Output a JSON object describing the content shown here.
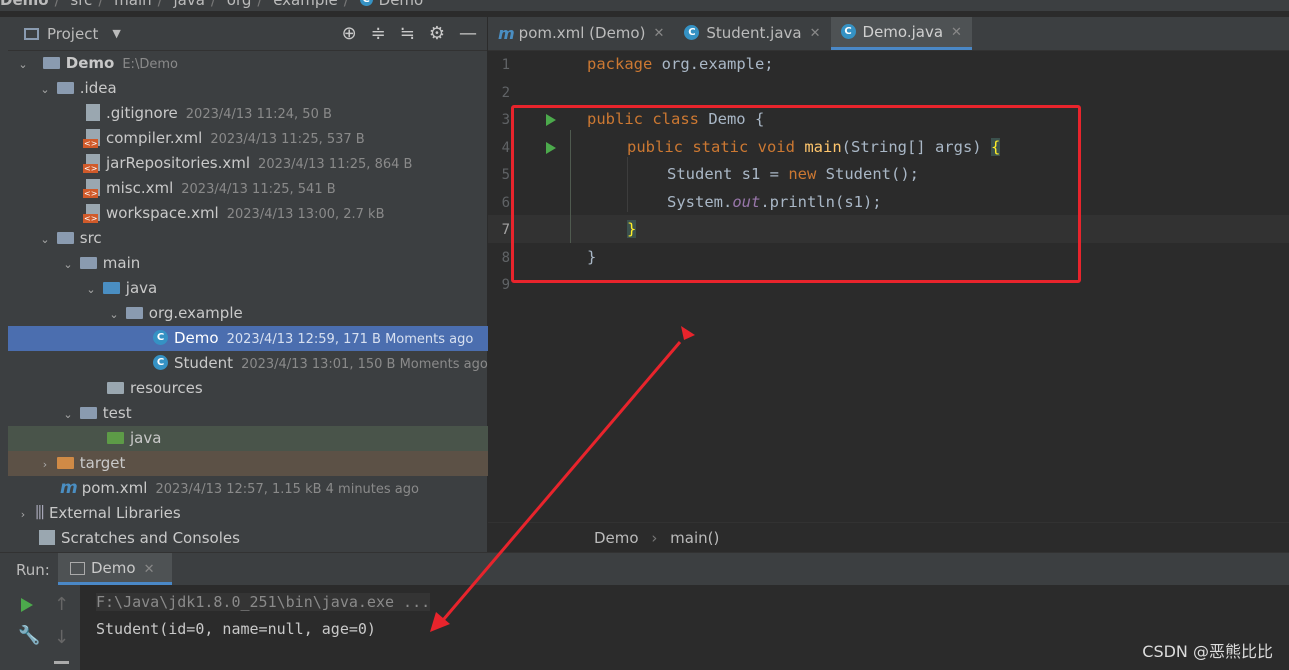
{
  "breadcrumb": [
    "Demo",
    "src",
    "main",
    "java",
    "org",
    "example",
    "Demo"
  ],
  "project_panel": {
    "title": "Project",
    "tree": [
      {
        "label": "Demo",
        "meta": "E:\\Demo",
        "kind": "module"
      },
      {
        "label": ".idea",
        "meta": "",
        "kind": "folder"
      },
      {
        "label": ".gitignore",
        "meta": "2023/4/13 11:24, 50 B",
        "kind": "git"
      },
      {
        "label": "compiler.xml",
        "meta": "2023/4/13 11:25, 537 B",
        "kind": "xml"
      },
      {
        "label": "jarRepositories.xml",
        "meta": "2023/4/13 11:25, 864 B",
        "kind": "xml"
      },
      {
        "label": "misc.xml",
        "meta": "2023/4/13 11:25, 541 B",
        "kind": "xml"
      },
      {
        "label": "workspace.xml",
        "meta": "2023/4/13 13:00, 2.7 kB",
        "kind": "xml"
      },
      {
        "label": "src",
        "meta": "",
        "kind": "folder"
      },
      {
        "label": "main",
        "meta": "",
        "kind": "folder"
      },
      {
        "label": "java",
        "meta": "",
        "kind": "folder-blue"
      },
      {
        "label": "org.example",
        "meta": "",
        "kind": "package"
      },
      {
        "label": "Demo",
        "meta": "2023/4/13 12:59, 171 B Moments ago",
        "kind": "class"
      },
      {
        "label": "Student",
        "meta": "2023/4/13 13:01, 150 B Moments ago",
        "kind": "class"
      },
      {
        "label": "resources",
        "meta": "",
        "kind": "folder-res"
      },
      {
        "label": "test",
        "meta": "",
        "kind": "folder"
      },
      {
        "label": "java",
        "meta": "",
        "kind": "folder-green"
      },
      {
        "label": "target",
        "meta": "",
        "kind": "folder-orange"
      },
      {
        "label": "pom.xml",
        "meta": "2023/4/13 12:57, 1.15 kB 4 minutes ago",
        "kind": "maven"
      },
      {
        "label": "External Libraries",
        "meta": "",
        "kind": "libs"
      },
      {
        "label": "Scratches and Consoles",
        "meta": "",
        "kind": "scratch"
      }
    ]
  },
  "editor": {
    "tabs": [
      {
        "label": "pom.xml (Demo)",
        "icon": "maven-icon"
      },
      {
        "label": "Student.java",
        "icon": "class-icon"
      },
      {
        "label": "Demo.java",
        "icon": "class-icon",
        "active": true
      }
    ],
    "line_numbers": [
      "1",
      "2",
      "3",
      "4",
      "5",
      "6",
      "7",
      "8",
      "9"
    ],
    "code": {
      "l1_kw": "package",
      "l1_rest": " org.example;",
      "l3_kw": "public class",
      "l3_rest": " Demo {",
      "l4_kw": "public static void",
      "l4_fn": "main",
      "l4_rest": "(String[] args) ",
      "l4_brace": "{",
      "l5_a": "Student s1 = ",
      "l5_kw": "new",
      "l5_b": " Student();",
      "l6_a": "System.",
      "l6_st": "out",
      "l6_b": ".println(s1);",
      "l7": "}",
      "l8": "}"
    },
    "breadcrumb": [
      "Demo",
      "main()"
    ]
  },
  "run_panel": {
    "label": "Run:",
    "tab": "Demo",
    "console": [
      "F:\\Java\\jdk1.8.0_251\\bin\\java.exe ...",
      "Student(id=0, name=null, age=0)"
    ]
  },
  "watermark": "CSDN @恶熊比比",
  "colors": {
    "accent": "#4a88c7",
    "annotation": "#e8242c",
    "selection": "#4b6eaf"
  }
}
